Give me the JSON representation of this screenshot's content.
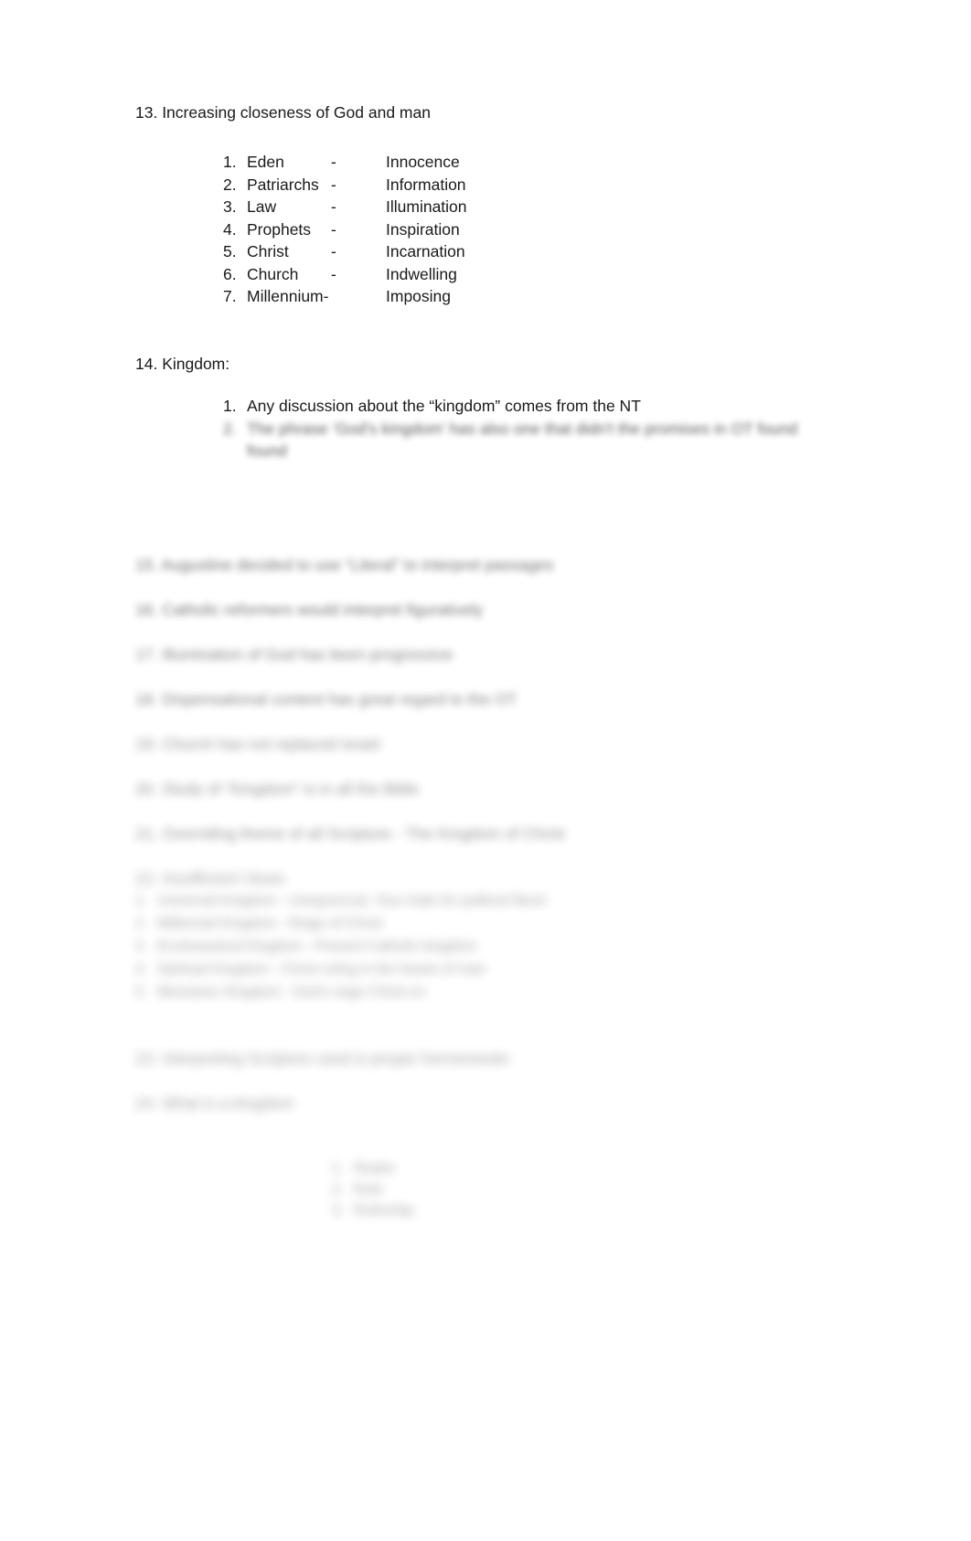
{
  "document": {
    "background_color": "#ffffff",
    "text_color": "#1a1a1a"
  },
  "section_13": {
    "heading": "13. Increasing closeness of God and man",
    "items": [
      {
        "num": "1.",
        "term": "Eden",
        "dash": "-",
        "value": "Innocence"
      },
      {
        "num": "2.",
        "term": "Patriarchs",
        "dash": "-",
        "value": "Information"
      },
      {
        "num": "3.",
        "term": "Law",
        "dash": "-",
        "value": "Illumination"
      },
      {
        "num": "4.",
        "term": "Prophets",
        "dash": "-",
        "value": "Inspiration"
      },
      {
        "num": "5.",
        "term": "Christ",
        "dash": "-",
        "value": "Incarnation"
      },
      {
        "num": "6.",
        "term": "Church",
        "dash": "-",
        "value": "Indwelling"
      },
      {
        "num": "7.",
        "term": "Millennium-",
        "dash": "",
        "value": "Imposing"
      }
    ]
  },
  "section_14": {
    "heading": "14. Kingdom:",
    "items": [
      {
        "num": "1.",
        "text": "Any discussion about the “kingdom” comes from the NT"
      },
      {
        "num": "2.",
        "text": "The phrase ‘God's kingdom' has also one that didn't the promises in OT found",
        "text_wrap": "found"
      }
    ]
  },
  "lower_sections": [
    {
      "num": "15.",
      "text": "Augustine decided to use “Literal” to interpret passages"
    },
    {
      "num": "16.",
      "text": "Catholic reformers would interpret figuratively"
    },
    {
      "num": "17.",
      "text": "Illumination of God has been progressive"
    },
    {
      "num": "18.",
      "text": "Dispensational content has great regard to the OT"
    },
    {
      "num": "19.",
      "text": "Church has not replaced Israel"
    },
    {
      "num": "20.",
      "text": "Study of “Kingdom” is in all the Bible"
    },
    {
      "num": "21.",
      "text": "Overriding theme of all Scripture - The Kingdom of Christ"
    },
    {
      "num": "22.",
      "text": "Insufficient Views"
    }
  ],
  "kingdom_views": [
    {
      "num": "1.",
      "text": "Universal Kingdom - Unequivocal, Your trials for political flavor"
    },
    {
      "num": "2.",
      "text": "Millennial Kingdom - Reign of Christ"
    },
    {
      "num": "3.",
      "text": "Ecclesiastical Kingdom - Present Catholic kingdom"
    },
    {
      "num": "4.",
      "text": "Spiritual Kingdom - Christ ruling in the hearts of man"
    },
    {
      "num": "5.",
      "text": "Messianic Kingdom - God's reign Christ on"
    }
  ],
  "closing_sections": [
    {
      "num": "23.",
      "text": "Interpreting Scripture used is proper hermeneutic"
    },
    {
      "num": "24.",
      "text": "What is a kingdom"
    }
  ],
  "kingdom_elements": [
    {
      "num": "1.",
      "text": "Realm"
    },
    {
      "num": "2.",
      "text": "Rule"
    },
    {
      "num": "3.",
      "text": "Rulership"
    }
  ]
}
